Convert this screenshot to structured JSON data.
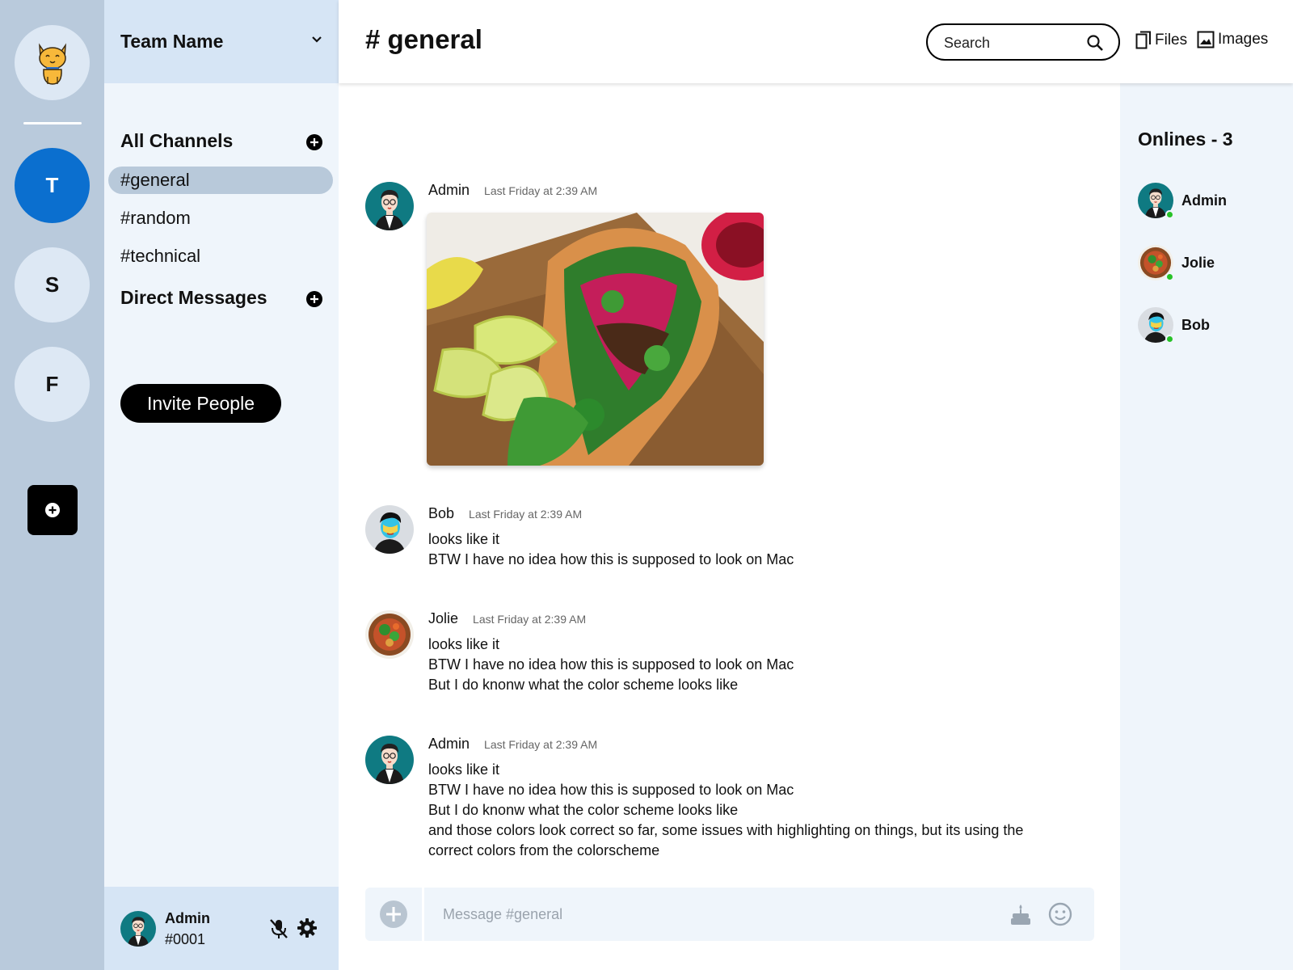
{
  "servers": {
    "items": [
      {
        "label": "T"
      },
      {
        "label": "S"
      },
      {
        "label": "F"
      }
    ]
  },
  "team": {
    "name": "Team Name"
  },
  "channels": {
    "section_title": "All Channels",
    "items": [
      "#general",
      "#random",
      "#technical"
    ],
    "active": "#general"
  },
  "direct_messages": {
    "section_title": "Direct Messages"
  },
  "invite": {
    "label": "Invite People"
  },
  "current_user": {
    "name": "Admin",
    "tag": "#0001"
  },
  "header": {
    "channel_title": "# general",
    "search_placeholder": "Search",
    "files_label": "Files",
    "images_label": "Images"
  },
  "messages": [
    {
      "author": "Admin",
      "time": "Last Friday at 2:39 AM",
      "avatar": "admin-avatar",
      "attachment": "sandwich-photo",
      "lines": []
    },
    {
      "author": "Bob",
      "time": "Last Friday at 2:39 AM",
      "avatar": "bob-avatar",
      "lines": [
        "looks like it",
        "BTW I have no idea how this is supposed to look on Mac"
      ]
    },
    {
      "author": "Jolie",
      "time": "Last Friday at 2:39 AM",
      "avatar": "jolie-avatar",
      "lines": [
        "looks like it",
        "BTW I have no idea how this is supposed to look on Mac",
        "But I do knonw what the color scheme looks like"
      ]
    },
    {
      "author": "Admin",
      "time": "Last Friday at 2:39 AM",
      "avatar": "admin-avatar",
      "lines": [
        "looks like it",
        "BTW I have no idea how this is supposed to look on Mac",
        "But I do knonw what the color scheme looks like",
        "and those colors look correct so far, some issues with highlighting on things, but its using the",
        "correct colors from the colorscheme"
      ]
    }
  ],
  "online": {
    "title": "Onlines - 3",
    "members": [
      {
        "name": "Admin",
        "status": "online"
      },
      {
        "name": "Jolie",
        "status": "online"
      },
      {
        "name": "Bob",
        "status": "online"
      }
    ]
  },
  "composer": {
    "placeholder": "Message #general"
  },
  "colors": {
    "rail": "#b9cadc",
    "sidebar": "#eff5fb",
    "team_header": "#d6e5f5",
    "active_server": "#0b6fcf",
    "active_channel": "#b8c9da",
    "online_dot": "#27c227"
  }
}
